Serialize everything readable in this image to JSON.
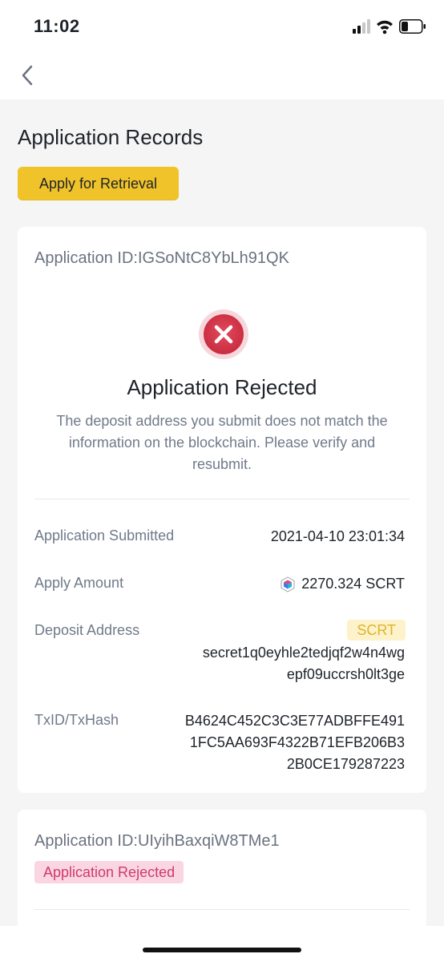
{
  "status_bar": {
    "time": "11:02",
    "icons": [
      "cellular-signal-icon",
      "wifi-icon",
      "battery-icon"
    ]
  },
  "nav": {
    "back_icon": "chevron-left-icon"
  },
  "page": {
    "title": "Application Records",
    "apply_button_label": "Apply for Retrieval"
  },
  "records": [
    {
      "application_id": "Application ID:IGSoNtC8YbLh91QK",
      "status_title": "Application Rejected",
      "status_description": "The deposit address you submit does not match the information on the blockchain. Please verify and resubmit.",
      "status_icon": "rejected-x-icon",
      "fields": {
        "submitted_label": "Application Submitted",
        "submitted_value": "2021-04-10 23:01:34",
        "amount_label": "Apply Amount",
        "amount_value": "2270.324 SCRT",
        "amount_icon": "scrt-coin-icon",
        "address_label": "Deposit Address",
        "address_tag": "SCRT",
        "address_line1": "secret1q0eyhle2tedjqf2w4n4wg",
        "address_line2": "epf09uccrsh0lt3ge",
        "txid_label": "TxID/TxHash",
        "txid_line1": "B4624C452C3C3E77ADBFFE491",
        "txid_line2": "1FC5AA693F4322B71EFB206B3",
        "txid_line3": "2B0CE179287223"
      }
    },
    {
      "application_id": "Application ID:UIyihBaxqiW8TMe1",
      "status_badge": "Application Rejected"
    }
  ],
  "colors": {
    "accent_yellow": "#f0c32b",
    "reject_red": "#d9384a",
    "badge_pink_bg": "#fad6e3",
    "badge_pink_text": "#cf3a6b",
    "tag_yellow_bg": "#fdf2c9",
    "tag_yellow_text": "#e0b42b"
  }
}
